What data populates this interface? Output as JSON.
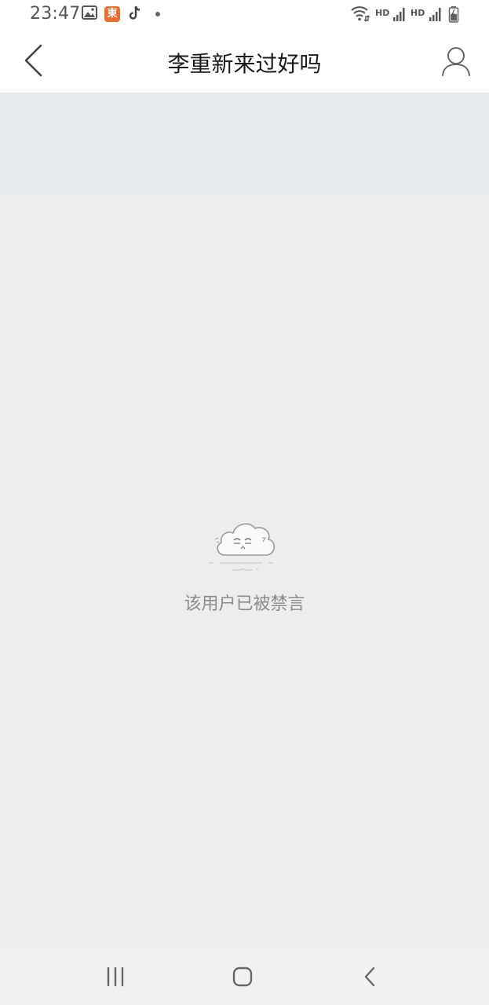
{
  "status_bar": {
    "time": "23:47",
    "app_badge": "東",
    "hd1": "HD",
    "hd2": "HD",
    "icons": [
      "gallery-icon",
      "app-badge-icon",
      "tiktok-icon",
      "notification-dot",
      "wifi-icon",
      "signal-icon",
      "signal-icon",
      "battery-icon"
    ]
  },
  "header": {
    "title": "李重新来过好吗",
    "back_icon": "chevron-left-icon",
    "profile_icon": "person-icon"
  },
  "empty_state": {
    "message": "该用户已被禁言",
    "illustration": "cloud-face-illustration"
  },
  "nav_bar": {
    "icons": [
      "recent-apps-icon",
      "home-icon",
      "back-icon"
    ]
  },
  "colors": {
    "background": "#ededee",
    "header": "#ffffff",
    "banner": "#e8e9ec",
    "message_text": "#8b8b8b"
  }
}
